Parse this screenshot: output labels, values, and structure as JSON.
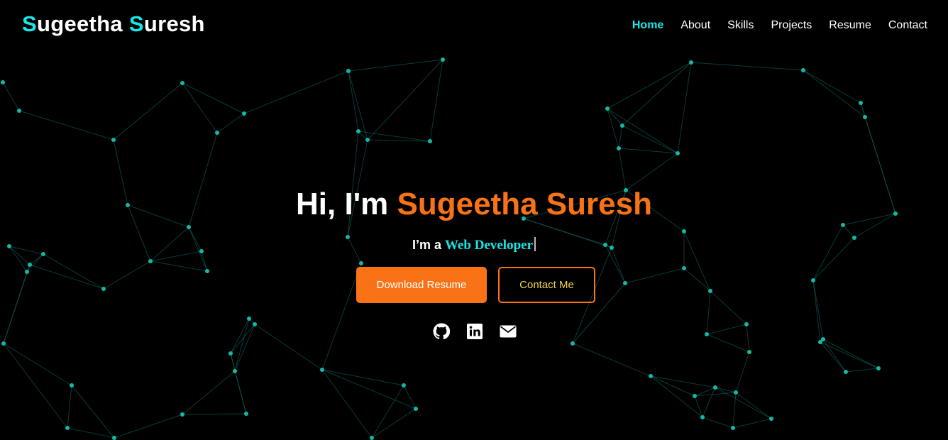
{
  "brand": {
    "first_cap": "S",
    "first_rest": "ugeetha",
    "last_cap": "S",
    "last_rest": "uresh"
  },
  "nav": {
    "items": [
      {
        "label": "Home",
        "active": true
      },
      {
        "label": "About"
      },
      {
        "label": "Skills"
      },
      {
        "label": "Projects"
      },
      {
        "label": "Resume"
      },
      {
        "label": "Contact"
      }
    ]
  },
  "hero": {
    "greeting": "Hi, I'm",
    "name": "Sugeetha Suresh",
    "subtitle_prefix": "I’m a",
    "role": "Web Developer"
  },
  "buttons": {
    "download": "Download Resume",
    "contact": "Contact Me"
  },
  "socials": [
    {
      "icon": "github-icon"
    },
    {
      "icon": "linkedin-icon"
    },
    {
      "icon": "mail-icon"
    }
  ],
  "colors": {
    "accent_cyan": "#19e6e6",
    "accent_orange": "#f97316",
    "contact_text": "#f0d34a",
    "background": "#000000"
  }
}
